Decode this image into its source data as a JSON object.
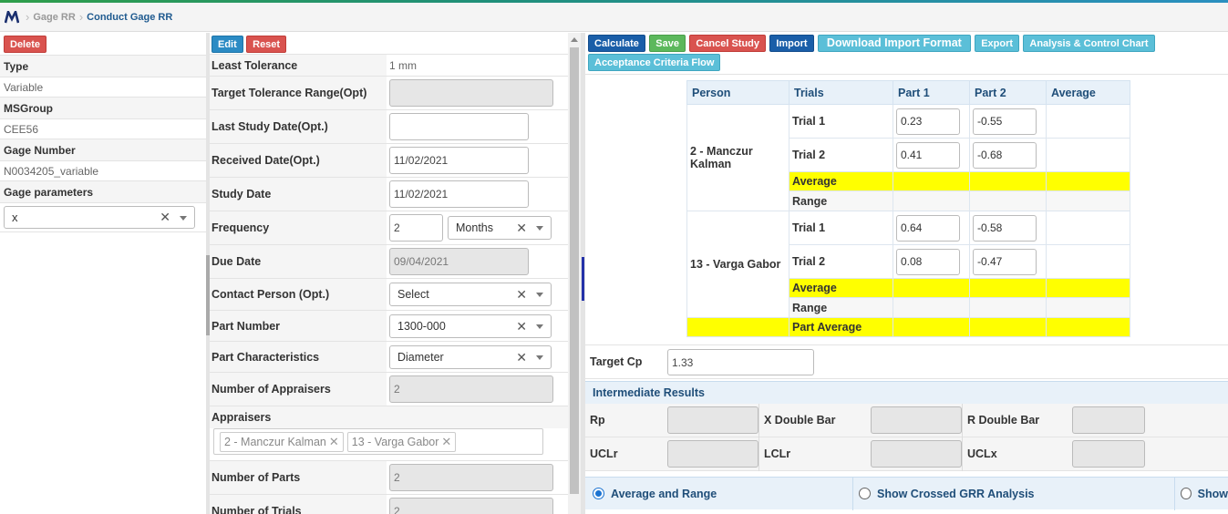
{
  "breadcrumb": {
    "items": [
      "Gage RR",
      "Conduct Gage RR"
    ]
  },
  "left": {
    "delete_label": "Delete",
    "fields": [
      {
        "label": "Type",
        "value": "Variable"
      },
      {
        "label": "MSGroup",
        "value": "CEE56"
      },
      {
        "label": "Gage Number",
        "value": "N0034205_variable"
      }
    ],
    "gage_params_label": "Gage parameters",
    "gage_params_value": "x"
  },
  "mid": {
    "edit_label": "Edit",
    "reset_label": "Reset",
    "least_tolerance_label": "Least Tolerance",
    "least_tolerance_value": "1 mm",
    "target_tol_label": "Target Tolerance Range(Opt)",
    "target_tol_value": "",
    "last_study_label": "Last Study Date(Opt.)",
    "last_study_value": "",
    "received_label": "Received Date(Opt.)",
    "received_value": "11/02/2021",
    "study_label": "Study Date",
    "study_value": "11/02/2021",
    "frequency_label": "Frequency",
    "frequency_num": "2",
    "frequency_unit": "Months",
    "due_label": "Due Date",
    "due_value": "09/04/2021",
    "contact_label": "Contact Person (Opt.)",
    "contact_value": "Select",
    "part_number_label": "Part Number",
    "part_number_value": "1300-000",
    "part_char_label": "Part Characteristics",
    "part_char_value": "Diameter",
    "num_appraisers_label": "Number of Appraisers",
    "num_appraisers_value": "2",
    "appraisers_label": "Appraisers",
    "appraisers": [
      "2 - Manczur Kalman",
      "13 - Varga Gabor"
    ],
    "num_parts_label": "Number of Parts",
    "num_parts_value": "2",
    "num_trials_label": "Number of Trials",
    "num_trials_value": "2"
  },
  "toolbar": {
    "calculate": "Calculate",
    "save": "Save",
    "cancel_study": "Cancel Study",
    "import": "Import",
    "download_format": "Download Import Format",
    "export": "Export",
    "analysis_chart": "Analysis & Control Chart",
    "acceptance_flow": "Acceptance Criteria Flow"
  },
  "grr_table": {
    "headers": [
      "Person",
      "Trials",
      "Part 1",
      "Part 2",
      "Average"
    ],
    "persons": [
      {
        "name": "2 - Manczur Kalman",
        "trials": [
          {
            "label": "Trial 1",
            "part1": "0.23",
            "part2": "-0.55"
          },
          {
            "label": "Trial 2",
            "part1": "0.41",
            "part2": "-0.68"
          }
        ],
        "average_label": "Average",
        "range_label": "Range"
      },
      {
        "name": "13 - Varga Gabor",
        "trials": [
          {
            "label": "Trial 1",
            "part1": "0.64",
            "part2": "-0.58"
          },
          {
            "label": "Trial 2",
            "part1": "0.08",
            "part2": "-0.47"
          }
        ],
        "average_label": "Average",
        "range_label": "Range"
      }
    ],
    "part_average_label": "Part Average"
  },
  "target_cp": {
    "label": "Target Cp",
    "value": "1.33"
  },
  "intermediate": {
    "title": "Intermediate Results",
    "row1": [
      "Rp",
      "X Double Bar",
      "R Double Bar"
    ],
    "row2": [
      "UCLr",
      "LCLr",
      "UCLx"
    ]
  },
  "radios": {
    "options": [
      "Average and Range",
      "Show Crossed GRR Analysis",
      "Show"
    ]
  },
  "colors": {
    "highlight": "#ffff00",
    "header_blue": "#1f4e79",
    "accent": "#2b8bc4"
  }
}
